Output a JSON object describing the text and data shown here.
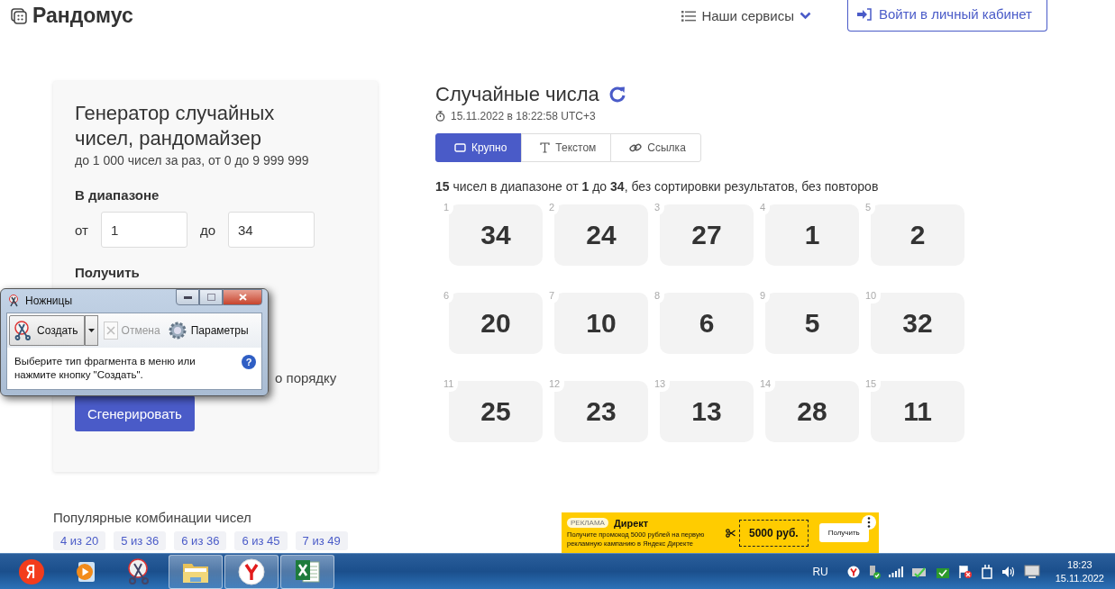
{
  "header": {
    "logo_text": "Рандомус",
    "services_menu": "Наши сервисы",
    "login_button": "Войти в личный кабинет"
  },
  "generator": {
    "title": "Генератор случайных чисел, рандомайзер",
    "subtitle": "до 1 000 чисел за раз, от 0 до 9 999 999",
    "range_label": "В диапазоне",
    "from_label": "от",
    "from_value": "1",
    "to_label": "до",
    "to_value": "34",
    "get_label": "Получить",
    "sort_fragment": "о порядку",
    "generate_button": "Сгенерировать"
  },
  "results": {
    "title": "Случайные числа",
    "timestamp": "15.11.2022 в 18:22:58 UTC+3",
    "tabs": [
      {
        "kind": "large",
        "label": "Крупно",
        "selected": true
      },
      {
        "kind": "text",
        "label": "Текстом",
        "selected": false
      },
      {
        "kind": "link",
        "label": "Ссылка",
        "selected": false
      }
    ],
    "summary": "**15** чисел в диапазоне от **1** до **34**, без сортировки результатов, без повторов",
    "numbers": [
      {
        "index": "1",
        "value": "34"
      },
      {
        "index": "2",
        "value": "24"
      },
      {
        "index": "3",
        "value": "27"
      },
      {
        "index": "4",
        "value": "1"
      },
      {
        "index": "5",
        "value": "2"
      },
      {
        "index": "6",
        "value": "20"
      },
      {
        "index": "7",
        "value": "10"
      },
      {
        "index": "8",
        "value": "6"
      },
      {
        "index": "9",
        "value": "5"
      },
      {
        "index": "10",
        "value": "32"
      },
      {
        "index": "11",
        "value": "25"
      },
      {
        "index": "12",
        "value": "23"
      },
      {
        "index": "13",
        "value": "13"
      },
      {
        "index": "14",
        "value": "28"
      },
      {
        "index": "15",
        "value": "11"
      }
    ]
  },
  "popular": {
    "title": "Популярные комбинации чисел",
    "chips": [
      "4 из 20",
      "5 из 36",
      "6 из 36",
      "6 из 45",
      "7 из 49"
    ]
  },
  "ad": {
    "badge": "РЕКЛАМА",
    "brand": "Директ",
    "text": "Получите промокод 5000 рублей на первую рекламную кампанию в Яндекс Директе",
    "coupon": "5000 руб.",
    "button": "Получить"
  },
  "snipping_tool": {
    "title": "Ножницы",
    "new_button": "Создать",
    "cancel_button": {
      "label": "Отмена",
      "disabled": true
    },
    "options_button": "Параметры",
    "help_button": "?",
    "message": "Выберите тип фрагмента в меню или нажмите кнопку \"Создать\"."
  },
  "taskbar": {
    "apps": [
      {
        "kind": "yandex",
        "running": false
      },
      {
        "kind": "media",
        "running": false
      },
      {
        "kind": "scissors",
        "running": false
      },
      {
        "kind": "folder",
        "running": true
      },
      {
        "kind": "browser",
        "running": true
      },
      {
        "kind": "excel",
        "running": true
      }
    ],
    "language": "RU",
    "clock_time": "18:23",
    "clock_date": "15.11.2022"
  }
}
